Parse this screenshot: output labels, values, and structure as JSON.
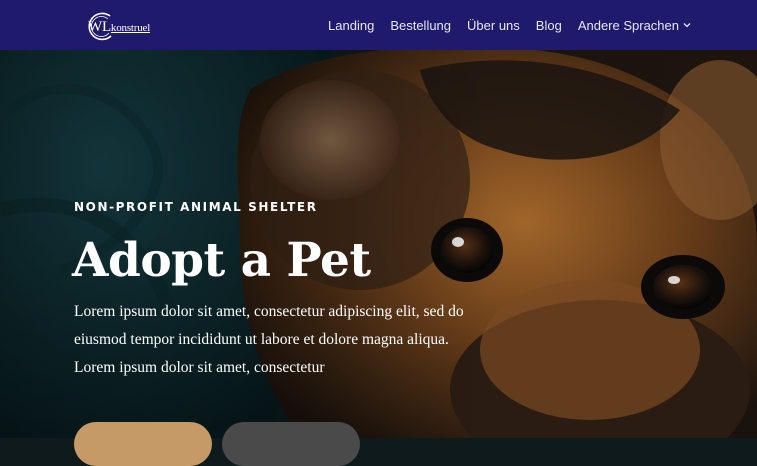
{
  "header": {
    "logo": {
      "text_big": "WL",
      "text_small": "konstruel"
    },
    "nav": [
      {
        "label": "Landing"
      },
      {
        "label": "Bestellung"
      },
      {
        "label": "Über uns"
      },
      {
        "label": "Blog"
      },
      {
        "label": "Andere Sprachen"
      }
    ],
    "bg_color": "#1f1a6b"
  },
  "hero": {
    "eyebrow": "NON-PROFIT ANIMAL SHELTER",
    "title": "Adopt a Pet",
    "description": "Lorem ipsum dolor sit amet, consectetur adipiscing elit, sed do eiusmod tempor incididunt ut labore et dolore magna aliqua. Lorem ipsum dolor sit amet, consectetur",
    "image_subject": "close-up of a black and tan dog looking at the camera",
    "buttons": [
      {
        "label": "",
        "color": "#c59a66"
      },
      {
        "label": "",
        "color": "#4a4a4a"
      }
    ]
  }
}
